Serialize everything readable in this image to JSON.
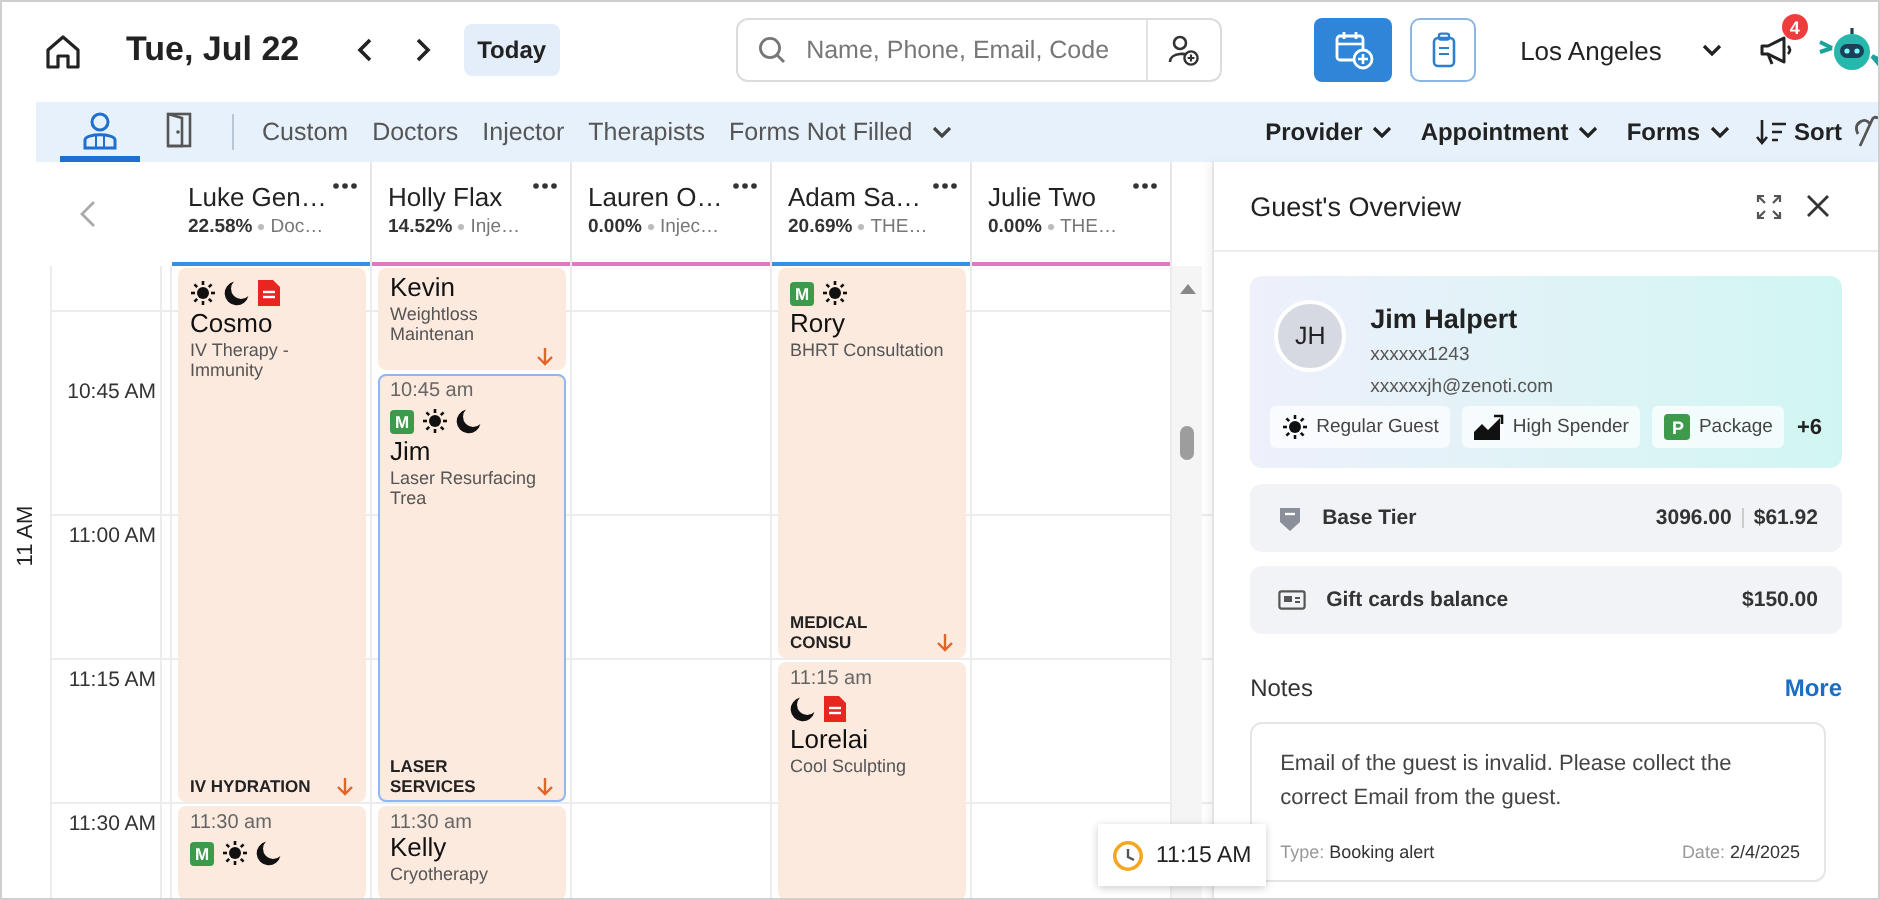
{
  "header": {
    "date": "Tue, Jul 22",
    "today_button": "Today",
    "search": {
      "placeholder": "Name, Phone, Email, Code"
    },
    "location": "Los Angeles",
    "notifications": {
      "count": "4"
    }
  },
  "toolbar": {
    "views": [
      {
        "kind": "providers",
        "selected": true
      },
      {
        "kind": "rooms",
        "selected": false
      }
    ],
    "filters": [
      "Custom",
      "Doctors",
      "Injector",
      "Therapists",
      "Forms Not Filled"
    ],
    "menus": [
      "Provider",
      "Appointment",
      "Forms"
    ],
    "sort": "Sort"
  },
  "calendar": {
    "time_group": "11 AM",
    "times": [
      "10:45 AM",
      "11:00 AM",
      "11:15 AM",
      "11:30 AM"
    ],
    "providers": [
      {
        "name": "Luke Gen…",
        "share": "22.58%",
        "role": "Doc…",
        "color": "#3b8fe2",
        "appointments": [
          {
            "badges": [
              {
                "kind": "day"
              },
              {
                "kind": "night"
              },
              {
                "kind": "form"
              }
            ],
            "guest": "Cosmo",
            "service": "IV Therapy - Immunity",
            "category": "IV HYDRATION",
            "arrow": true,
            "selected": false
          },
          {
            "time": "11:30 am",
            "badges": [
              {
                "kind": "member",
                "label": "M"
              },
              {
                "kind": "day"
              },
              {
                "kind": "night"
              }
            ],
            "arrow": false,
            "selected": false
          }
        ]
      },
      {
        "name": "Holly Flax",
        "share": "14.52%",
        "role": "Inje…",
        "color": "#e07ac0",
        "appointments": [
          {
            "guest": "Kevin",
            "service": "Weightloss Maintenan",
            "arrow": true,
            "selected": false
          },
          {
            "time": "10:45 am",
            "badges": [
              {
                "kind": "member",
                "label": "M"
              },
              {
                "kind": "day"
              },
              {
                "kind": "night"
              }
            ],
            "guest": "Jim",
            "service": "Laser Resurfacing Trea",
            "category": "LASER SERVICES",
            "arrow": true,
            "selected": true
          },
          {
            "time": "11:30 am",
            "guest": "Kelly",
            "service": "Cryotherapy",
            "arrow": false,
            "selected": false
          }
        ]
      },
      {
        "name": "Lauren O…",
        "share": "0.00%",
        "role": "Injec…",
        "color": "#e07ac0"
      },
      {
        "name": "Adam Sa…",
        "share": "20.69%",
        "role": "THE…",
        "color": "#3b8fe2",
        "appointments": [
          {
            "badges": [
              {
                "kind": "member",
                "label": "M"
              },
              {
                "kind": "day"
              }
            ],
            "guest": "Rory",
            "service": "BHRT Consultation",
            "category": "MEDICAL CONSU",
            "arrow": true,
            "selected": false
          },
          {
            "time": "11:15 am",
            "badges": [
              {
                "kind": "night"
              },
              {
                "kind": "form"
              }
            ],
            "guest": "Lorelai",
            "service": "Cool Sculpting",
            "arrow": false,
            "selected": false
          }
        ]
      },
      {
        "name": "Julie Two",
        "share": "0.00%",
        "role": "THE…",
        "color": "#e07ac0"
      }
    ],
    "now_marker": "11:15 AM"
  },
  "guest_overview": {
    "title": "Guest's Overview",
    "guest": {
      "initials": "JH",
      "name": "Jim Halpert",
      "phone": "xxxxxx1243",
      "email": "xxxxxxjh@zenoti.com",
      "tags": [
        {
          "kind": "regular",
          "label": "Regular Guest"
        },
        {
          "kind": "spender",
          "label": "High Spender"
        },
        {
          "kind": "package",
          "icon_label": "P",
          "label": "Package"
        }
      ],
      "more_tags": "+6"
    },
    "balances": [
      {
        "kind": "tier",
        "label": "Base Tier",
        "values": [
          "3096.00",
          "$61.92"
        ]
      },
      {
        "kind": "gift",
        "label": "Gift cards balance",
        "values": [
          "$150.00"
        ]
      }
    ],
    "notes": {
      "title": "Notes",
      "more": "More",
      "items": [
        {
          "text": "Email of the guest is invalid. Please collect the correct Email from the guest.",
          "type_label": "Type:",
          "type": "Booking alert",
          "date_label": "Date:",
          "date": "2/4/2025"
        }
      ]
    }
  }
}
